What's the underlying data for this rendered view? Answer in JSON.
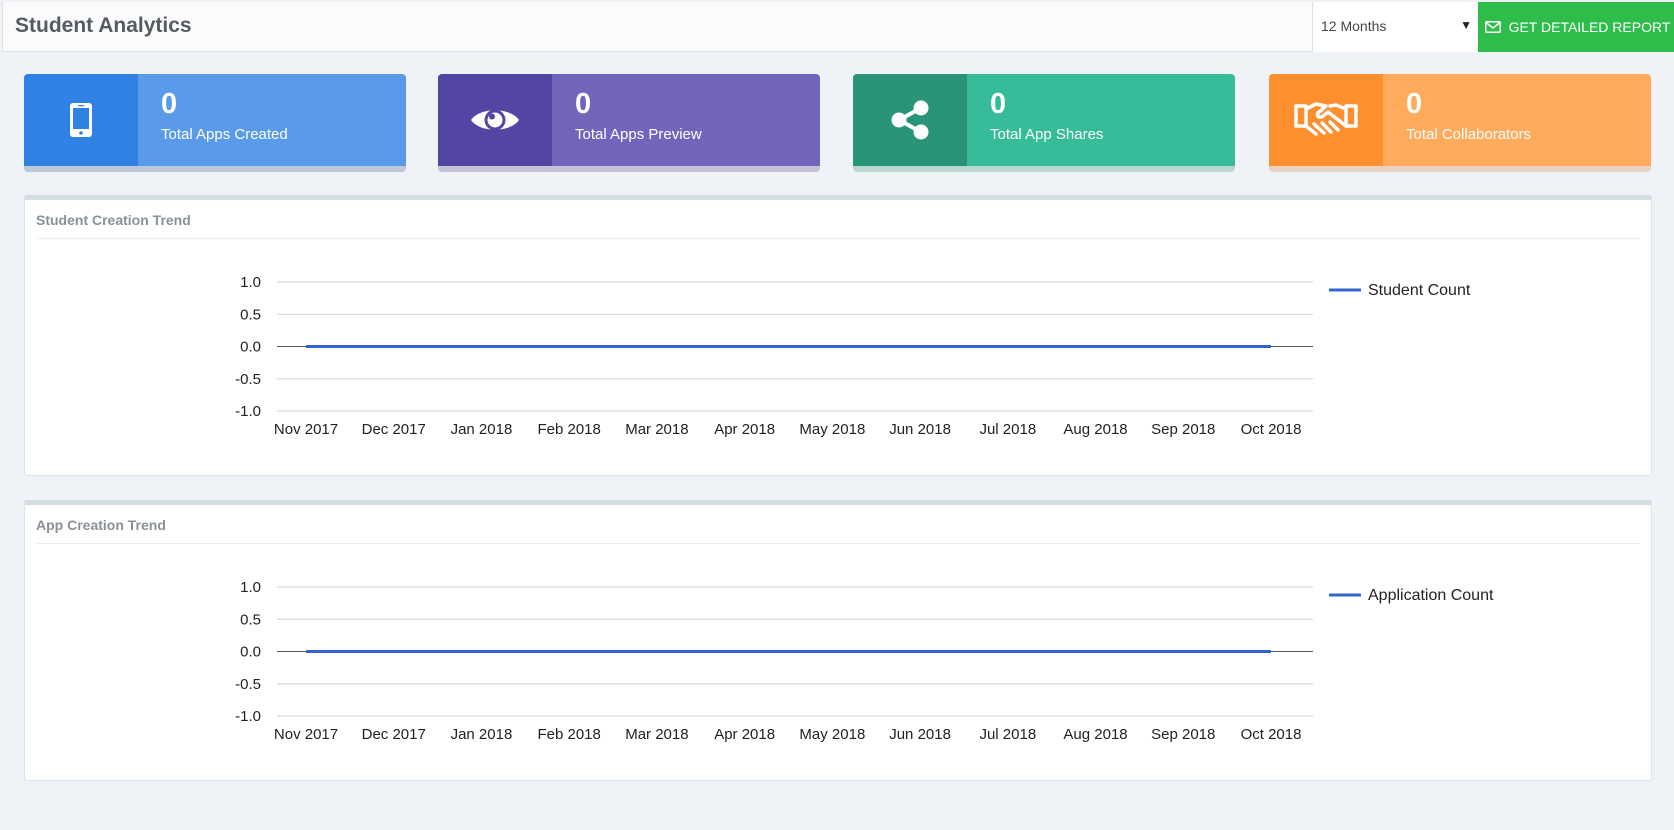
{
  "header": {
    "title": "Student Analytics",
    "period_select": {
      "value": "12 Months"
    },
    "report_button": {
      "label": "GET DETAILED REPORT"
    }
  },
  "stats": [
    {
      "value": "0",
      "label": "Total Apps Created",
      "icon": "phone-icon",
      "icon_color": "#2f82e3",
      "body_color": "#5a9be9",
      "bottom_color": "#bcc9d8"
    },
    {
      "value": "0",
      "label": "Total Apps Preview",
      "icon": "eye-icon",
      "icon_color": "#5346a3",
      "body_color": "#7266bc",
      "bottom_color": "#c4c1d8"
    },
    {
      "value": "0",
      "label": "Total App Shares",
      "icon": "share-icon",
      "icon_color": "#2a9478",
      "body_color": "#36bc9a",
      "bottom_color": "#b9d7cf"
    },
    {
      "value": "0",
      "label": "Total Collaborators",
      "icon": "handshake-icon",
      "icon_color": "#fd8f2f",
      "body_color": "#ffab5b",
      "bottom_color": "#e6d3c1"
    }
  ],
  "panels": [
    {
      "title": "Student Creation Trend"
    },
    {
      "title": "App Creation Trend"
    }
  ],
  "chart_data": [
    {
      "type": "line",
      "title": "Student Creation Trend",
      "categories": [
        "Nov 2017",
        "Dec 2017",
        "Jan 2018",
        "Feb 2018",
        "Mar 2018",
        "Apr 2018",
        "May 2018",
        "Jun 2018",
        "Jul 2018",
        "Aug 2018",
        "Sep 2018",
        "Oct 2018"
      ],
      "series": [
        {
          "name": "Student Count",
          "values": [
            0,
            0,
            0,
            0,
            0,
            0,
            0,
            0,
            0,
            0,
            0,
            0
          ],
          "color": "#3366cc"
        }
      ],
      "yticks": [
        "1.0",
        "0.5",
        "0.0",
        "-0.5",
        "-1.0"
      ],
      "ylim": [
        -1,
        1
      ],
      "grid": true,
      "legend": "right"
    },
    {
      "type": "line",
      "title": "App Creation Trend",
      "categories": [
        "Nov 2017",
        "Dec 2017",
        "Jan 2018",
        "Feb 2018",
        "Mar 2018",
        "Apr 2018",
        "May 2018",
        "Jun 2018",
        "Jul 2018",
        "Aug 2018",
        "Sep 2018",
        "Oct 2018"
      ],
      "series": [
        {
          "name": "Application Count",
          "values": [
            0,
            0,
            0,
            0,
            0,
            0,
            0,
            0,
            0,
            0,
            0,
            0
          ],
          "color": "#3366cc"
        }
      ],
      "yticks": [
        "1.0",
        "0.5",
        "0.0",
        "-0.5",
        "-1.0"
      ],
      "ylim": [
        -1,
        1
      ],
      "grid": true,
      "legend": "right"
    }
  ]
}
